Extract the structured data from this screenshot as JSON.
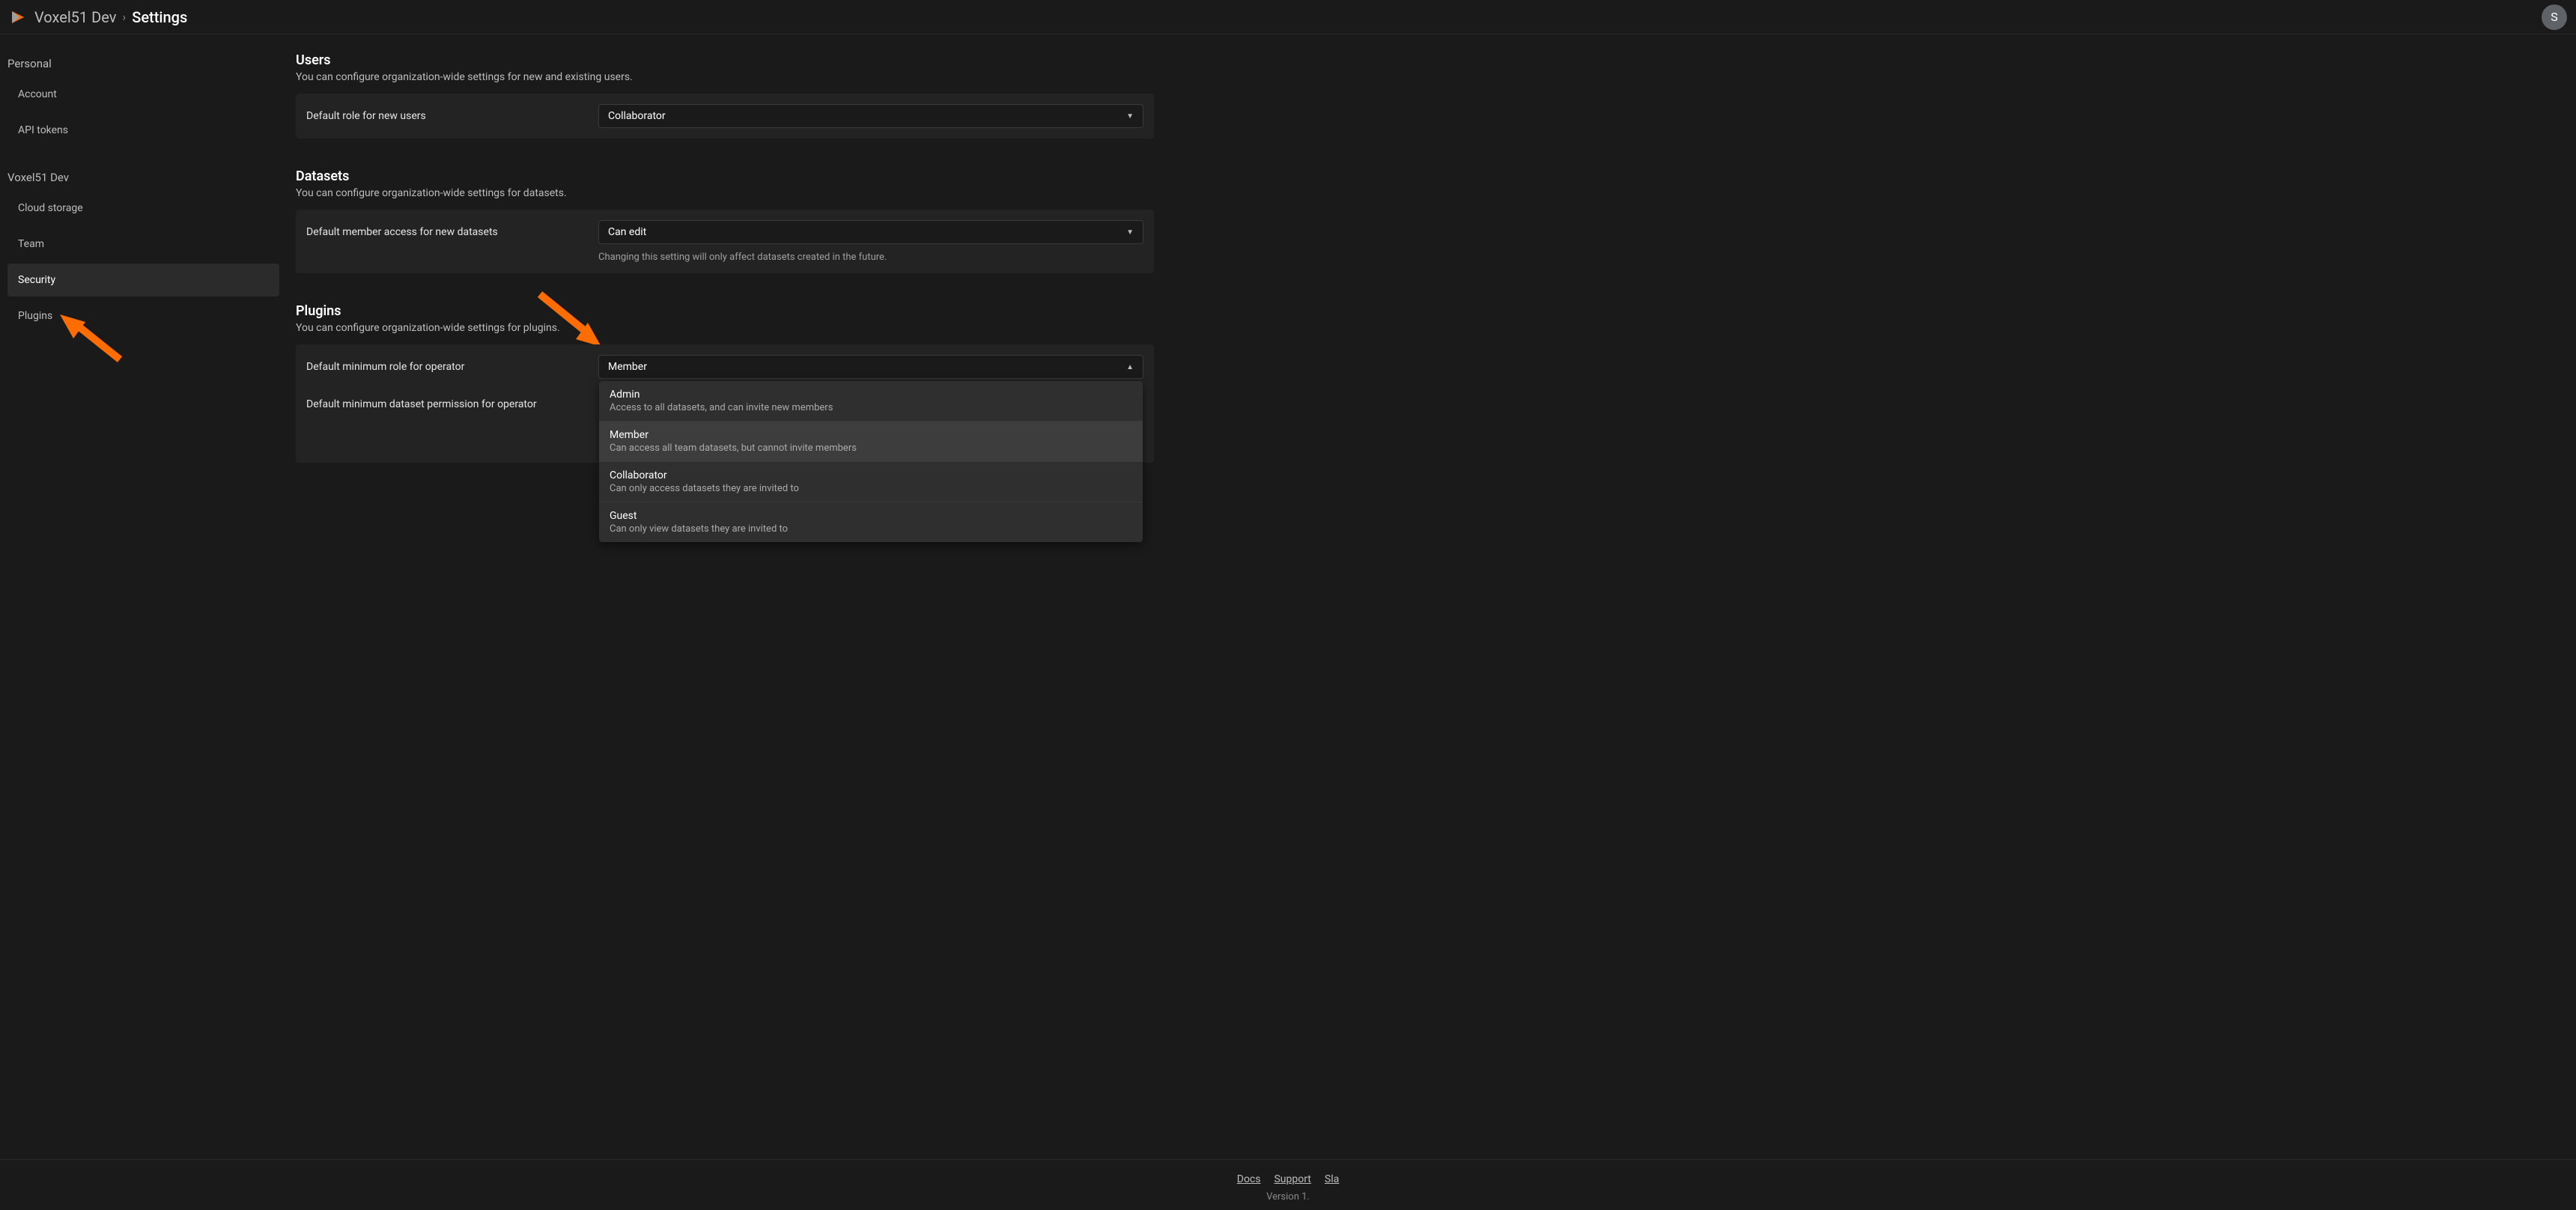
{
  "header": {
    "org": "Voxel51 Dev",
    "page": "Settings",
    "avatar_initial": "S"
  },
  "sidebar": {
    "section1_label": "Personal",
    "section2_label": "Voxel51 Dev",
    "items": [
      {
        "label": "Account"
      },
      {
        "label": "API tokens"
      },
      {
        "label": "Cloud storage"
      },
      {
        "label": "Team"
      },
      {
        "label": "Security"
      },
      {
        "label": "Plugins"
      }
    ]
  },
  "users": {
    "title": "Users",
    "desc": "You can configure organization-wide settings for new and existing users.",
    "row_label": "Default role for new users",
    "select_value": "Collaborator"
  },
  "datasets": {
    "title": "Datasets",
    "desc": "You can configure organization-wide settings for datasets.",
    "row_label": "Default member access for new datasets",
    "select_value": "Can edit",
    "hint": "Changing this setting will only affect datasets created in the future."
  },
  "plugins": {
    "title": "Plugins",
    "desc": "You can configure organization-wide settings for plugins.",
    "row1_label": "Default minimum role for operator",
    "row1_value": "Member",
    "row2_label": "Default minimum dataset permission for operator",
    "dropdown": [
      {
        "title": "Admin",
        "desc": "Access to all datasets, and can invite new members"
      },
      {
        "title": "Member",
        "desc": "Can access all team datasets, but cannot invite members"
      },
      {
        "title": "Collaborator",
        "desc": "Can only access datasets they are invited to"
      },
      {
        "title": "Guest",
        "desc": "Can only view datasets they are invited to"
      }
    ]
  },
  "footer": {
    "links": [
      "Docs",
      "Support",
      "Sla"
    ],
    "version": "Version 1."
  }
}
